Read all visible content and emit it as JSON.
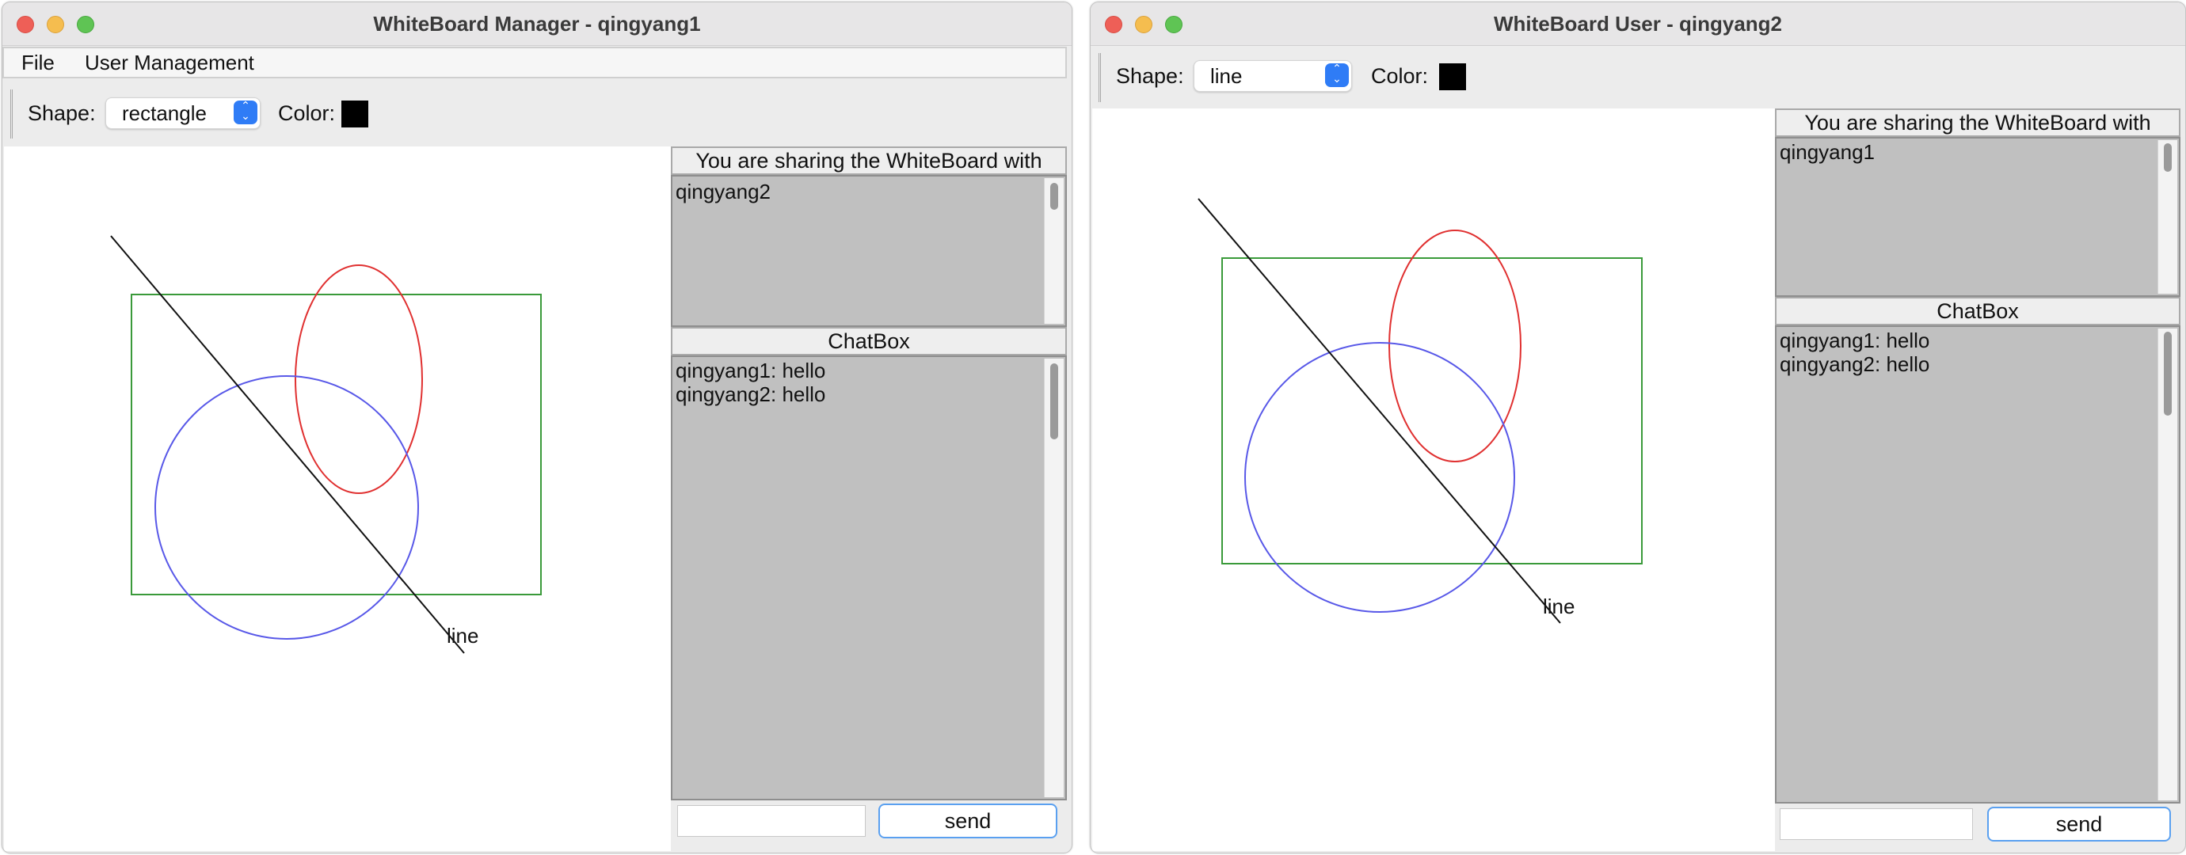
{
  "manager_window": {
    "title": "WhiteBoard Manager - qingyang1",
    "menu": [
      "File",
      "User Management"
    ],
    "toolbar": {
      "shape_label": "Shape:",
      "shape_value": "rectangle",
      "color_label": "Color:",
      "color_value": "#000000"
    },
    "canvas": {
      "line_label": "line"
    },
    "sharing": {
      "header": "You are sharing the WhiteBoard with",
      "users": [
        "qingyang2"
      ]
    },
    "chat": {
      "header": "ChatBox",
      "messages": [
        "qingyang1: hello",
        "qingyang2: hello"
      ],
      "input_value": "",
      "send_label": "send"
    }
  },
  "user_window": {
    "title": "WhiteBoard User - qingyang2",
    "toolbar": {
      "shape_label": "Shape:",
      "shape_value": "line",
      "color_label": "Color:",
      "color_value": "#000000"
    },
    "canvas": {
      "line_label": "line"
    },
    "sharing": {
      "header": "You are sharing the WhiteBoard with",
      "users": [
        "qingyang1"
      ]
    },
    "chat": {
      "header": "ChatBox",
      "messages": [
        "qingyang1: hello",
        "qingyang2: hello"
      ],
      "input_value": "",
      "send_label": "send"
    }
  },
  "shape_colors": {
    "rectangle": "#3a9a3a",
    "oval": "#e03030",
    "circle": "#5858e8",
    "line": "#111111"
  }
}
